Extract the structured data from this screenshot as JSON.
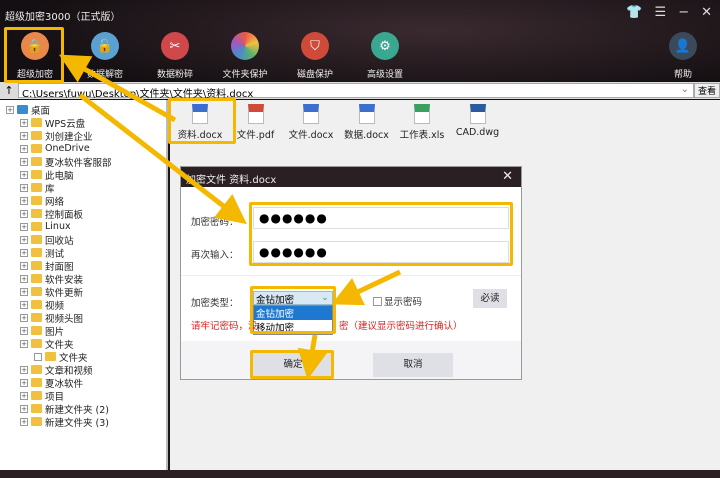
{
  "app": {
    "title": "超级加密3000（正式版）",
    "window_buttons": [
      "skin-icon",
      "menu-icon",
      "minimize-icon",
      "close-icon"
    ]
  },
  "toolbar": [
    {
      "label": "超级加密",
      "color": "#e8884a",
      "icon": "lock"
    },
    {
      "label": "数据解密",
      "color": "#5aa0d0",
      "icon": "unlock"
    },
    {
      "label": "数据粉碎",
      "color": "#d0484a",
      "icon": "scissors"
    },
    {
      "label": "文件夹保护",
      "color": "#e8e0d0",
      "icon": "palette"
    },
    {
      "label": "磁盘保护",
      "color": "#d04a3a",
      "icon": "shield"
    },
    {
      "label": "高级设置",
      "color": "#3aa890",
      "icon": "gear"
    },
    {
      "label": "帮助",
      "color": "#3a4a5a",
      "icon": "user"
    }
  ],
  "path": {
    "up": "↑",
    "value": "C:\\Users\\fuwu\\Desktop\\文件夹\\文件夹\\资料.docx",
    "view": "查看"
  },
  "tree": [
    {
      "label": "桌面",
      "level": 0
    },
    {
      "label": "WPS云盘",
      "level": 1
    },
    {
      "label": "刘创建企业",
      "level": 1
    },
    {
      "label": "OneDrive",
      "level": 1
    },
    {
      "label": "夏冰软件客服部",
      "level": 1
    },
    {
      "label": "此电脑",
      "level": 1
    },
    {
      "label": "库",
      "level": 1
    },
    {
      "label": "网络",
      "level": 1
    },
    {
      "label": "控制面板",
      "level": 1
    },
    {
      "label": "Linux",
      "level": 1
    },
    {
      "label": "回收站",
      "level": 1
    },
    {
      "label": "测试",
      "level": 1
    },
    {
      "label": "封面图",
      "level": 1
    },
    {
      "label": "软件安装",
      "level": 1
    },
    {
      "label": "软件更新",
      "level": 1
    },
    {
      "label": "视频",
      "level": 1
    },
    {
      "label": "视频头图",
      "level": 1
    },
    {
      "label": "图片",
      "level": 1
    },
    {
      "label": "文件夹",
      "level": 1
    },
    {
      "label": "文件夹",
      "level": 2
    },
    {
      "label": "文章和视频",
      "level": 1
    },
    {
      "label": "夏冰软件",
      "level": 1
    },
    {
      "label": "项目",
      "level": 1
    },
    {
      "label": "新建文件夹 (2)",
      "level": 1
    },
    {
      "label": "新建文件夹 (3)",
      "level": 1
    }
  ],
  "files": [
    {
      "name": "资料.docx",
      "badge": "W",
      "color": "#3a6fd0"
    },
    {
      "name": "文件.pdf",
      "badge": "P",
      "color": "#d04a3a"
    },
    {
      "name": "文件.docx",
      "badge": "W",
      "color": "#3a6fd0"
    },
    {
      "name": "数据.docx",
      "badge": "W",
      "color": "#3a6fd0"
    },
    {
      "name": "工作表.xls",
      "badge": "X",
      "color": "#3aa060"
    },
    {
      "name": "CAD.dwg",
      "badge": "DWG",
      "color": "#2a5aa0"
    }
  ],
  "dialog": {
    "title": "加密文件 资料.docx",
    "close": "✕",
    "password_label": "加密密码：",
    "password": "●●●●●●",
    "confirm_label": "再次输入：",
    "confirm": "●●●●●●",
    "type_label": "加密类型：",
    "type_value": "金钻加密",
    "type_options": [
      "金钻加密",
      "移动加密"
    ],
    "show_password": "显示密码",
    "must_read": "必读",
    "warning_left": "请牢记密码，没",
    "warning_right": "密（建议显示密码进行确认）",
    "ok": "确定",
    "cancel": "取消"
  },
  "accent": "#f5b800"
}
